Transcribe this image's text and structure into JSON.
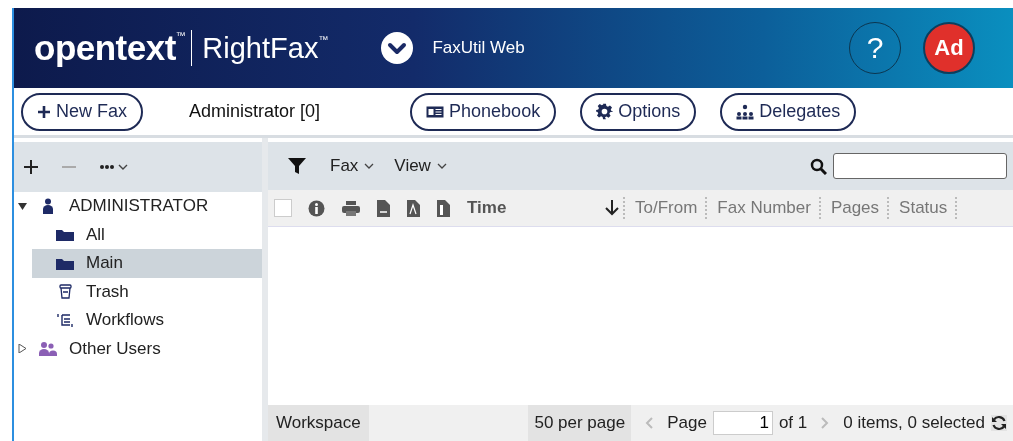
{
  "header": {
    "logo": "opentext$^{™}$",
    "product": "RightFax$^{™}$",
    "app_switch": "FaxUtil Web",
    "help": "?",
    "avatar": "Ad"
  },
  "toolbar": {
    "new_fax": "New Fax",
    "user": "Administrator [0]",
    "buttons": [
      {
        "kind": "phonebook",
        "label": "Phonebook"
      },
      {
        "kind": "options",
        "label": "Options"
      },
      {
        "kind": "delegates",
        "label": "Delegates"
      }
    ]
  },
  "sidebar": {
    "tree": [
      {
        "kind": "user",
        "label": "ADMINISTRATOR",
        "expanded": true,
        "selected": false,
        "children": [
          {
            "kind": "folder",
            "label": "All",
            "selected": false
          },
          {
            "kind": "folder",
            "label": "Main",
            "selected": true
          },
          {
            "kind": "trash",
            "label": "Trash",
            "selected": false
          },
          {
            "kind": "workflow",
            "label": "Workflows",
            "selected": false
          }
        ]
      },
      {
        "kind": "users",
        "label": "Other Users",
        "expanded": false,
        "selected": false
      }
    ]
  },
  "main": {
    "menus": [
      "Fax",
      "View"
    ],
    "columns": [
      {
        "kind": "checkbox",
        "checked": false
      },
      {
        "kind": "info"
      },
      {
        "kind": "print"
      },
      {
        "kind": "doc"
      },
      {
        "kind": "pdf"
      },
      {
        "kind": "file"
      },
      {
        "kind": "text",
        "label": "Time",
        "sorted": true
      },
      {
        "kind": "text",
        "label": "To/From",
        "sorted": false
      },
      {
        "kind": "text",
        "label": "Fax Number",
        "sorted": false
      },
      {
        "kind": "text",
        "label": "Pages",
        "sorted": false
      },
      {
        "kind": "text",
        "label": "Status",
        "sorted": false
      }
    ],
    "footer": {
      "workspace": "Workspace",
      "per_page": "50 per page",
      "page_label": "Page",
      "page": "1",
      "of": "of 1",
      "summary": "0 items, 0 selected"
    }
  }
}
